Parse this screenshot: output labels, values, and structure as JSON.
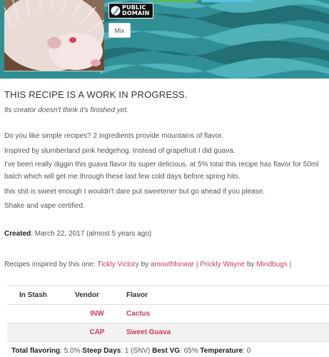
{
  "header": {
    "badge": {
      "line1": "PUBLIC",
      "line2": "DOMAIN",
      "icon": "public-domain-pen-icon"
    },
    "mix_label": "Mix",
    "colors": {
      "band": "#2f8f95",
      "wave_dark": "#1f6f76",
      "wave_light": "#48aab0",
      "btn_green": "#5cb85c",
      "btn_blue": "#5bc0de"
    }
  },
  "recipe": {
    "title": "THIS RECIPE IS A WORK IN PROGRESS.",
    "subtitle": "Its creator doesn't think it's finished yet.",
    "paragraphs": [
      "Do you like simple recipes? 2 ingredients provide mountains of flavor.",
      "Inspired by slumberland pink hedgehog. Instead of grapefruit I did guava.",
      "I've been really diggin this guava flavor its super delicious. at 5% total this recipe has flavor for 50ml batch which will get me through these last few cold days before spring hits.",
      "this shit is sweet enough I wouldn't dare put sweetener but go ahead if you please.",
      "Shake and vape certified."
    ],
    "created_label": "Created",
    "created_value": ": March 22, 2017 (almost 5 years ago)"
  },
  "inspired": {
    "prefix": "Recipes inspired by this one: ",
    "items": [
      {
        "recipe": "Tickly Victory",
        "by": " by ",
        "author": "amouthforwar"
      },
      {
        "recipe": "Prickly Wayne",
        "by": " by ",
        "author": "Mindbugs"
      }
    ],
    "separator": " | "
  },
  "table": {
    "headers": [
      "In Stash",
      "Vendor",
      "Flavor"
    ],
    "rows": [
      {
        "stash": "",
        "vendor": "INW",
        "flavor": "Cactus"
      },
      {
        "stash": "",
        "vendor": "CAP",
        "flavor": "Sweet Guava"
      }
    ]
  },
  "footer": {
    "total_label": "Total flavoring",
    "total_value": ": 5.0% ",
    "steep_label": "Steep Days",
    "steep_value": ": 1 (SNV) ",
    "vg_label": "Best VG",
    "vg_value": ": 65% ",
    "temp_label": "Temperature",
    "temp_value": ": 0"
  }
}
